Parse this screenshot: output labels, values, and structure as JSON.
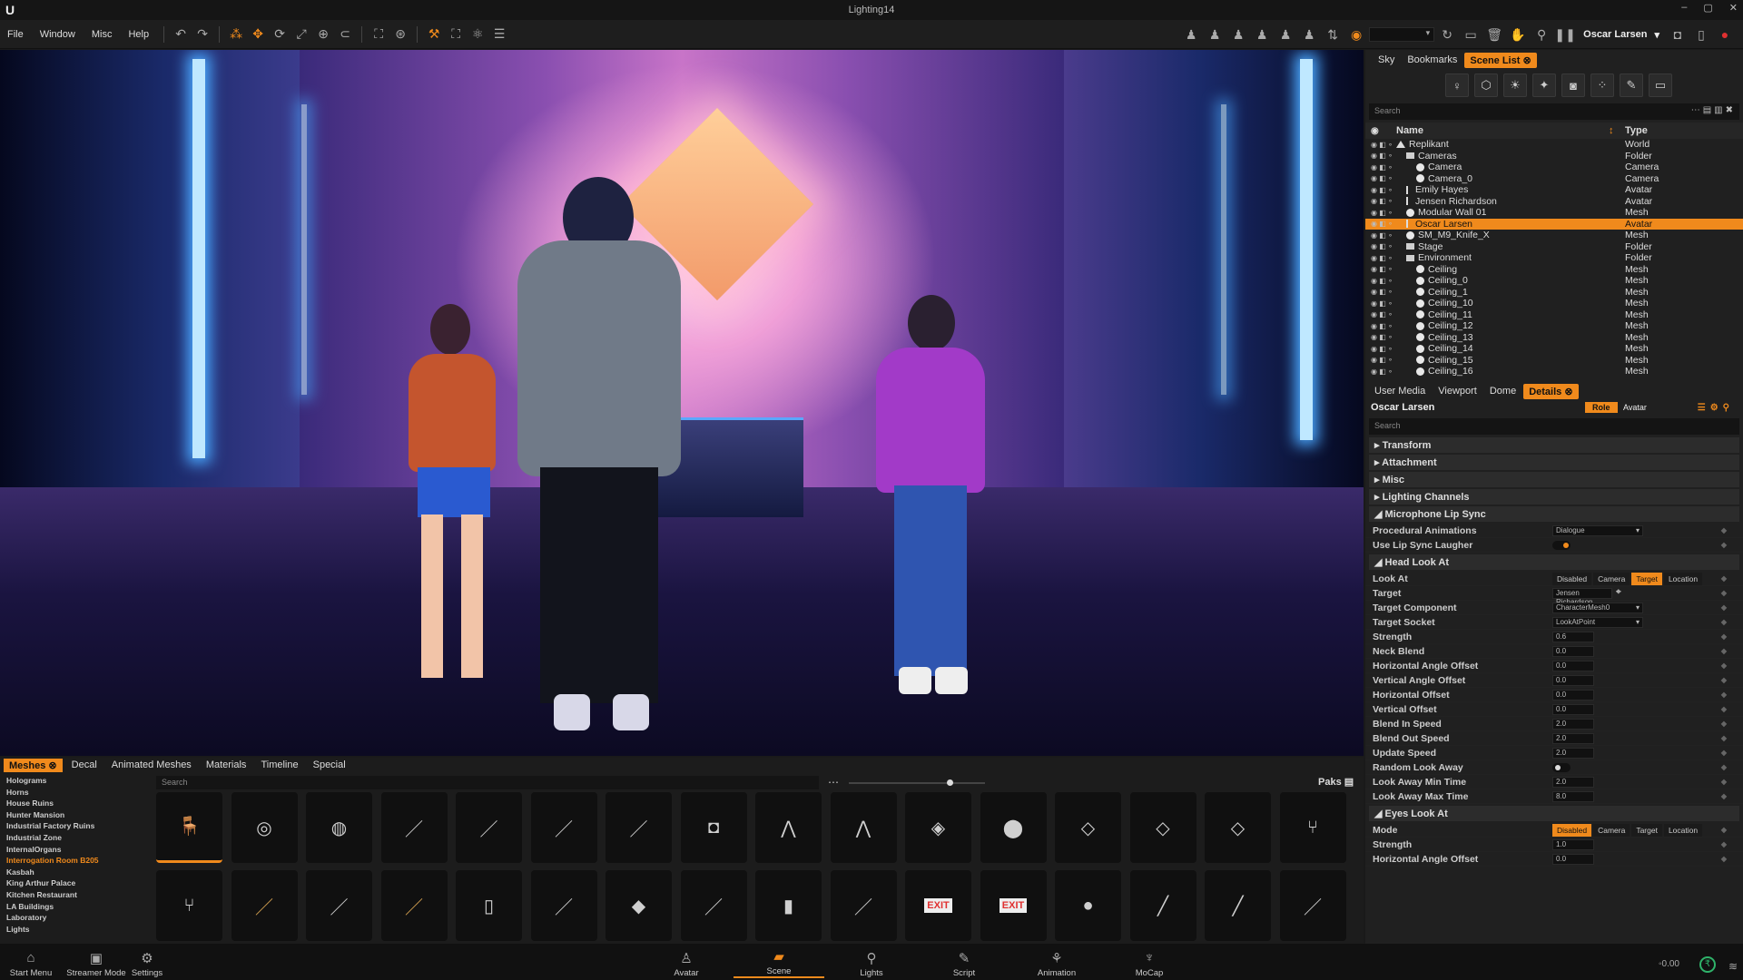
{
  "window": {
    "title": "Lighting14"
  },
  "menu": [
    "File",
    "Window",
    "Misc",
    "Help"
  ],
  "toolbar": {
    "user": "Oscar Larsen"
  },
  "scene_tabs": [
    {
      "label": "Sky",
      "active": false
    },
    {
      "label": "Bookmarks",
      "active": false
    },
    {
      "label": "Scene List",
      "active": true
    }
  ],
  "outliner": {
    "search_placeholder": "Search",
    "col_name": "Name",
    "col_type": "Type",
    "rows": [
      {
        "name": "Replikant",
        "type": "World",
        "icon": "world",
        "indent": 0
      },
      {
        "name": "Cameras",
        "type": "Folder",
        "icon": "folder",
        "indent": 1
      },
      {
        "name": "Camera",
        "type": "Camera",
        "icon": "dot",
        "indent": 2
      },
      {
        "name": "Camera_0",
        "type": "Camera",
        "icon": "dot",
        "indent": 2
      },
      {
        "name": "Emily Hayes",
        "type": "Avatar",
        "icon": "avatar",
        "indent": 1
      },
      {
        "name": "Jensen Richardson",
        "type": "Avatar",
        "icon": "avatar",
        "indent": 1
      },
      {
        "name": "Modular Wall 01",
        "type": "Mesh",
        "icon": "dot",
        "indent": 1
      },
      {
        "name": "Oscar Larsen",
        "type": "Avatar",
        "icon": "avatar",
        "indent": 1,
        "selected": true
      },
      {
        "name": "SM_M9_Knife_X",
        "type": "Mesh",
        "icon": "dot",
        "indent": 1
      },
      {
        "name": "Stage",
        "type": "Folder",
        "icon": "folder",
        "indent": 1
      },
      {
        "name": "Environment",
        "type": "Folder",
        "icon": "folder",
        "indent": 1
      },
      {
        "name": "Ceiling",
        "type": "Mesh",
        "icon": "dot",
        "indent": 2
      },
      {
        "name": "Ceiling_0",
        "type": "Mesh",
        "icon": "dot",
        "indent": 2
      },
      {
        "name": "Ceiling_1",
        "type": "Mesh",
        "icon": "dot",
        "indent": 2
      },
      {
        "name": "Ceiling_10",
        "type": "Mesh",
        "icon": "dot",
        "indent": 2
      },
      {
        "name": "Ceiling_11",
        "type": "Mesh",
        "icon": "dot",
        "indent": 2
      },
      {
        "name": "Ceiling_12",
        "type": "Mesh",
        "icon": "dot",
        "indent": 2
      },
      {
        "name": "Ceiling_13",
        "type": "Mesh",
        "icon": "dot",
        "indent": 2
      },
      {
        "name": "Ceiling_14",
        "type": "Mesh",
        "icon": "dot",
        "indent": 2
      },
      {
        "name": "Ceiling_15",
        "type": "Mesh",
        "icon": "dot",
        "indent": 2
      },
      {
        "name": "Ceiling_16",
        "type": "Mesh",
        "icon": "dot",
        "indent": 2
      }
    ]
  },
  "details_tabs": [
    {
      "label": "User Media",
      "active": false
    },
    {
      "label": "Viewport",
      "active": false
    },
    {
      "label": "Dome",
      "active": false
    },
    {
      "label": "Details",
      "active": true
    }
  ],
  "details": {
    "object_name": "Oscar Larsen",
    "role_label": "Role",
    "avatar_label": "Avatar",
    "search_placeholder": "Search",
    "collapsed_sections": [
      "Transform",
      "Attachment",
      "Misc",
      "Lighting Channels"
    ],
    "mic_section": "Microphone Lip Sync",
    "mic_props": [
      {
        "label": "Procedural Animations",
        "kind": "dropdown",
        "value": "Dialogue"
      },
      {
        "label": "Use Lip Sync Laugher",
        "kind": "toggle",
        "on": true
      }
    ],
    "head_section": "Head Look At",
    "head_props": [
      {
        "label": "Look At",
        "kind": "segment",
        "options": [
          "Disabled",
          "Camera",
          "Target",
          "Location"
        ],
        "selected": "Target"
      },
      {
        "label": "Target",
        "kind": "picker",
        "value": "Jensen Richardson"
      },
      {
        "label": "Target Component",
        "kind": "dropdown",
        "value": "CharacterMesh0"
      },
      {
        "label": "Target Socket",
        "kind": "dropdown",
        "value": "LookAtPoint"
      },
      {
        "label": "Strength",
        "kind": "number",
        "value": "0.6"
      },
      {
        "label": "Neck Blend",
        "kind": "number",
        "value": "0.0"
      },
      {
        "label": "Horizontal Angle Offset",
        "kind": "number",
        "value": "0.0"
      },
      {
        "label": "Vertical Angle Offset",
        "kind": "number",
        "value": "0.0"
      },
      {
        "label": "Horizontal Offset",
        "kind": "number",
        "value": "0.0"
      },
      {
        "label": "Vertical Offset",
        "kind": "number",
        "value": "0.0"
      },
      {
        "label": "Blend In Speed",
        "kind": "number",
        "value": "2.0"
      },
      {
        "label": "Blend Out Speed",
        "kind": "number",
        "value": "2.0"
      },
      {
        "label": "Update Speed",
        "kind": "number",
        "value": "2.0"
      },
      {
        "label": "Random Look Away",
        "kind": "toggle",
        "on": false
      },
      {
        "label": "Look Away Min Time",
        "kind": "number",
        "value": "2.0"
      },
      {
        "label": "Look Away Max Time",
        "kind": "number",
        "value": "8.0"
      }
    ],
    "eyes_section": "Eyes Look At",
    "eyes_props": [
      {
        "label": "Mode",
        "kind": "segment",
        "options": [
          "Disabled",
          "Camera",
          "Target",
          "Location"
        ],
        "selected": "Disabled"
      },
      {
        "label": "Strength",
        "kind": "number",
        "value": "1.0"
      },
      {
        "label": "Horizontal Angle Offset",
        "kind": "number",
        "value": "0.0"
      }
    ]
  },
  "asset_tabs": [
    {
      "label": "Meshes",
      "active": true
    },
    {
      "label": "Decal",
      "active": false
    },
    {
      "label": "Animated Meshes",
      "active": false
    },
    {
      "label": "Materials",
      "active": false
    },
    {
      "label": "Timeline",
      "active": false
    },
    {
      "label": "Special",
      "active": false
    }
  ],
  "assets": {
    "search_placeholder": "Search",
    "paks_label": "Paks",
    "zoom_level": 0.75,
    "categories": [
      "Holograms",
      "Horns",
      "House Ruins",
      "Hunter Mansion",
      "Industrial Factory Ruins",
      "Industrial Zone",
      "InternalOrgans",
      "Interrogation Room B205",
      "Kasbah",
      "King Arthur Palace",
      "Kitchen Restaurant",
      "LA Buildings",
      "Laboratory",
      "Lights"
    ],
    "active_category": "Interrogation Room B205",
    "tile_icons": [
      "chair-icon",
      "ashtray-icon",
      "bowl-icon",
      "cable-icon",
      "rod-icon",
      "wire-icon",
      "bracket-icon",
      "camera-prop-icon",
      "tripod-icon",
      "tripod-icon",
      "paper-icon",
      "puck-icon",
      "panel-icon",
      "panel-icon",
      "panel-icon",
      "metal-chair-icon",
      "metal-chair-icon",
      "pen-icon",
      "soap-icon",
      "pencil-icon",
      "pillar-icon",
      "tape-icon",
      "sheet-icon",
      "slab-icon",
      "box-icon",
      "pole-icon",
      "exit-sign-icon",
      "exit-sign-icon",
      "disc-icon",
      "tube-light-icon",
      "tube-light-icon",
      "rod-icon"
    ]
  },
  "bottom_nav": [
    {
      "label": "Start Menu",
      "icon": "home-icon"
    },
    {
      "label": "Streamer Mode",
      "icon": "monitor-icon"
    },
    {
      "label": "Settings",
      "icon": "gear-icon"
    },
    {
      "label": "Avatar",
      "icon": "avatar-icon"
    },
    {
      "label": "Scene",
      "icon": "scene-icon",
      "active": true
    },
    {
      "label": "Lights",
      "icon": "bulb-icon"
    },
    {
      "label": "Script",
      "icon": "script-icon"
    },
    {
      "label": "Animation",
      "icon": "animation-icon"
    },
    {
      "label": "MoCap",
      "icon": "mocap-icon"
    }
  ],
  "status": {
    "value": "0.00"
  },
  "colors": {
    "accent": "#f08a1c",
    "panel": "#202020"
  }
}
